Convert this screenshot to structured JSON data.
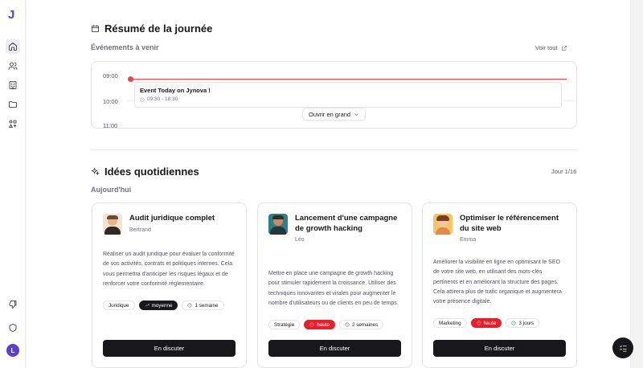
{
  "app": {
    "logo_letter": "J",
    "user_initial": "L"
  },
  "sidebar": {
    "items": [
      {
        "icon": "home-icon",
        "active": true
      },
      {
        "icon": "users-icon"
      },
      {
        "icon": "building-icon"
      },
      {
        "icon": "folder-icon"
      },
      {
        "icon": "shapes-icon"
      }
    ],
    "bottom": [
      {
        "icon": "thumbs-down-icon"
      },
      {
        "icon": "shield-icon"
      }
    ]
  },
  "summary": {
    "title": "Résumé de la journée",
    "events_label": "Événements à venir",
    "see_all": "Voir tout",
    "times": [
      "09:00",
      "10:00",
      "11:00"
    ],
    "event": {
      "title": "Event Today on Jynova !",
      "time": "09:30 - 18:30"
    },
    "open_button": "Ouvrir en grand"
  },
  "ideas": {
    "title": "Idées quotidiennes",
    "day_counter": "Jour 1/16",
    "today_label": "Aujourd'hui",
    "cards": [
      {
        "title": "Audit juridique complet",
        "author": "Bertrand",
        "description": "Réaliser un audit juridique pour évaluer la conformité de vos activités, contrats et politiques internes. Cela vous permettra d'anticiper les risques légaux et de renforcer votre conformité réglementaire.",
        "category": "Juridique",
        "priority": "moyenne",
        "duration": "1 semaine",
        "cta": "En discuter"
      },
      {
        "title": "Lancement d'une campagne de growth hacking",
        "author": "Léo",
        "description": "Mettre en place une campagne de growth hacking pour stimuler rapidement la croissance. Utiliser des techniques innovantes et virales pour augmenter le nombre d'utilisateurs ou de clients en peu de temps.",
        "category": "Stratégie",
        "priority": "haute",
        "duration": "2 semaines",
        "cta": "En discuter"
      },
      {
        "title": "Optimiser le référencement du site web",
        "author": "Emma",
        "description": "Améliorer la visibilité en ligne en optimisant le SEO de votre site web, en utilisant des mots-clés pertinents et en améliorant la structure des pages. Cela attirera plus de trafic organique et augmentera votre présence digitale.",
        "category": "Marketing",
        "priority": "haute",
        "duration": "3 jours",
        "cta": "En discuter"
      }
    ]
  },
  "colors": {
    "accent": "#5b3fd1",
    "now_line": "#e5484d",
    "high_priority": "#e5202b",
    "dark": "#18181b"
  }
}
